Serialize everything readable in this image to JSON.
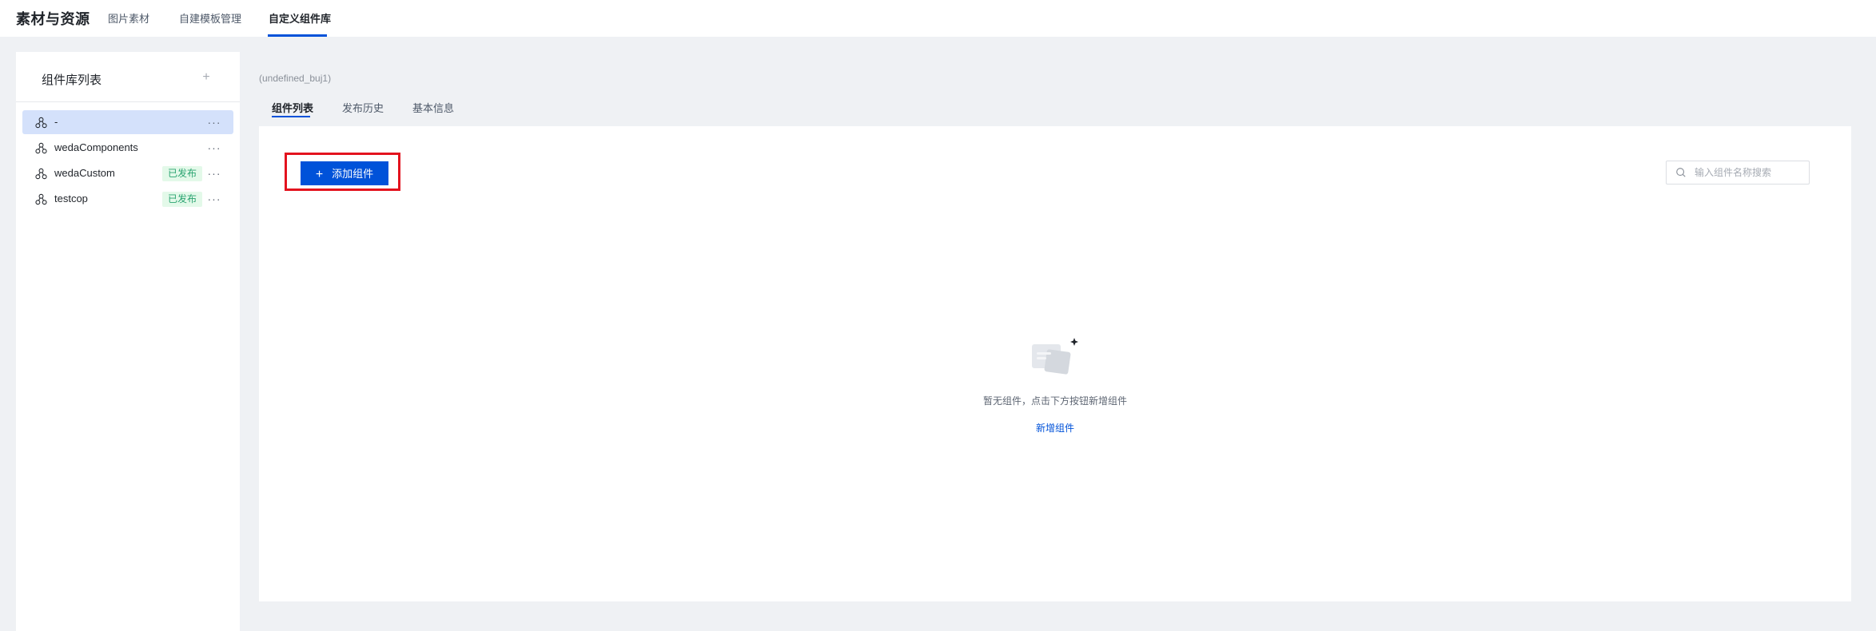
{
  "app": {
    "title": "素材与资源",
    "nav_tabs": [
      {
        "label": "图片素材"
      },
      {
        "label": "自建模板管理"
      },
      {
        "label": "自定义组件库"
      }
    ]
  },
  "sidebar": {
    "title": "组件库列表",
    "add_icon": "plus-icon",
    "items": [
      {
        "name": "-",
        "badge": "",
        "selected": true
      },
      {
        "name": "wedaComponents",
        "badge": ""
      },
      {
        "name": "wedaCustom",
        "badge": "已发布"
      },
      {
        "name": "testcop",
        "badge": "已发布"
      }
    ],
    "more_glyph": "···"
  },
  "main": {
    "breadcrumb": "(undefined_buj1)",
    "tabs": [
      {
        "label": "组件列表"
      },
      {
        "label": "发布历史"
      },
      {
        "label": "基本信息"
      }
    ],
    "add_button_label": "添加组件",
    "search": {
      "placeholder": "输入组件名称搜索",
      "value": ""
    },
    "empty": {
      "text": "暂无组件，点击下方按钮新增组件",
      "link": "新增组件"
    }
  },
  "colors": {
    "accent": "#0052d9",
    "selected_bg": "#d4e1fb",
    "badge_text": "#2ba471",
    "badge_bg": "#e3f9e9",
    "highlight": "#e3131e"
  }
}
